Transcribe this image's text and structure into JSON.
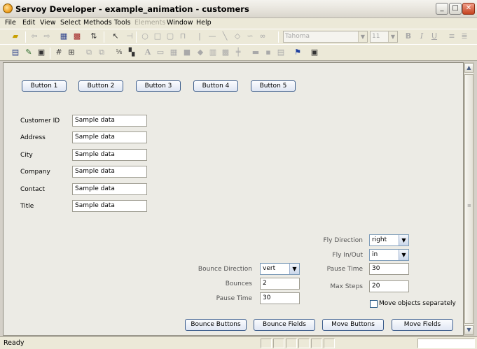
{
  "window": {
    "title": "Servoy Developer - example_animation - customers",
    "minimize_glyph": "_",
    "maximize_glyph": "□",
    "close_glyph": "✕"
  },
  "menu": [
    "File",
    "Edit",
    "View",
    "Select",
    "Methods",
    "Tools",
    "Elements",
    "Window",
    "Help"
  ],
  "toolbar": {
    "font_name": "Tahoma",
    "font_size": "11",
    "bold": "B",
    "italic": "I",
    "underline": "U"
  },
  "form": {
    "buttons": [
      "Button 1",
      "Button 2",
      "Button 3",
      "Button 4",
      "Button 5"
    ],
    "fields": [
      {
        "label": "Customer ID",
        "value": "Sample data"
      },
      {
        "label": "Address",
        "value": "Sample data"
      },
      {
        "label": "City",
        "value": "Sample data"
      },
      {
        "label": "Company",
        "value": "Sample data"
      },
      {
        "label": "Contact",
        "value": "Sample data"
      },
      {
        "label": "Title",
        "value": "Sample data"
      }
    ],
    "fly": {
      "direction_label": "Fly Direction",
      "direction_value": "right",
      "inout_label": "Fly In/Out",
      "inout_value": "in",
      "pause_label": "Pause Time",
      "pause_value": "30",
      "maxsteps_label": "Max Steps",
      "maxsteps_value": "20",
      "separate_label": "Move objects separately"
    },
    "bounce": {
      "direction_label": "Bounce Direction",
      "direction_value": "vert",
      "bounces_label": "Bounces",
      "bounces_value": "2",
      "pause_label": "Pause Time",
      "pause_value": "30"
    },
    "actions": [
      "Bounce Buttons",
      "Bounce Fields",
      "Move Buttons",
      "Move Fields"
    ]
  },
  "status": {
    "text": "Ready"
  }
}
